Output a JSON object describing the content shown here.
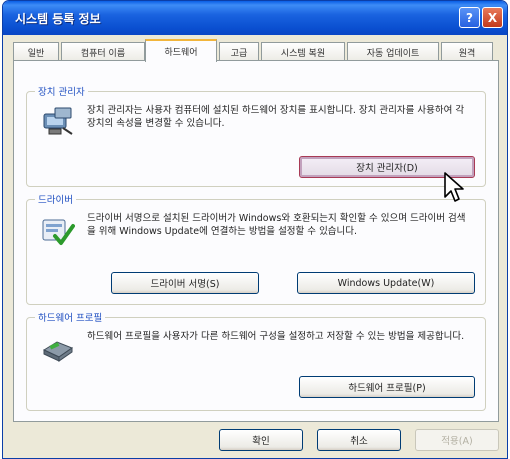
{
  "window": {
    "title": "시스템 등록 정보",
    "help_glyph": "?",
    "close_glyph": "X"
  },
  "tabs": [
    {
      "label": "일반",
      "active": false
    },
    {
      "label": "컴퓨터 이름",
      "active": false
    },
    {
      "label": "하드웨어",
      "active": true
    },
    {
      "label": "고급",
      "active": false
    },
    {
      "label": "시스템 복원",
      "active": false
    },
    {
      "label": "자동 업데이트",
      "active": false
    },
    {
      "label": "원격",
      "active": false
    }
  ],
  "device_manager": {
    "title": "장치 관리자",
    "description": "장치 관리자는 사용자 컴퓨터에 설치된 하드웨어 장치를 표시합니다. 장치 관리자를 사용하여 각 장치의 속성을 변경할 수 있습니다.",
    "button": "장치 관리자(D)"
  },
  "drivers": {
    "title": "드라이버",
    "description": "드라이버 서명으로 설치된 드라이버가 Windows와 호환되는지 확인할 수 있으며 드라이버 검색을 위해 Windows Update에 연결하는 방법을 설정할 수 있습니다.",
    "signing_button": "드라이버 서명(S)",
    "update_button": "Windows Update(W)"
  },
  "hardware_profiles": {
    "title": "하드웨어 프로필",
    "description": "하드웨어 프로필을 사용자가 다른 하드웨어 구성을 설정하고 저장할 수 있는 방법을 제공합니다.",
    "button": "하드웨어 프로필(P)"
  },
  "footer": {
    "ok": "확인",
    "cancel": "취소",
    "apply": "적용(A)"
  },
  "colors": {
    "title_bar": "#0a54d6",
    "window_bg": "#ece9d8",
    "group_title": "#1f4fc1",
    "active_tab_accent": "#f2b53b"
  }
}
